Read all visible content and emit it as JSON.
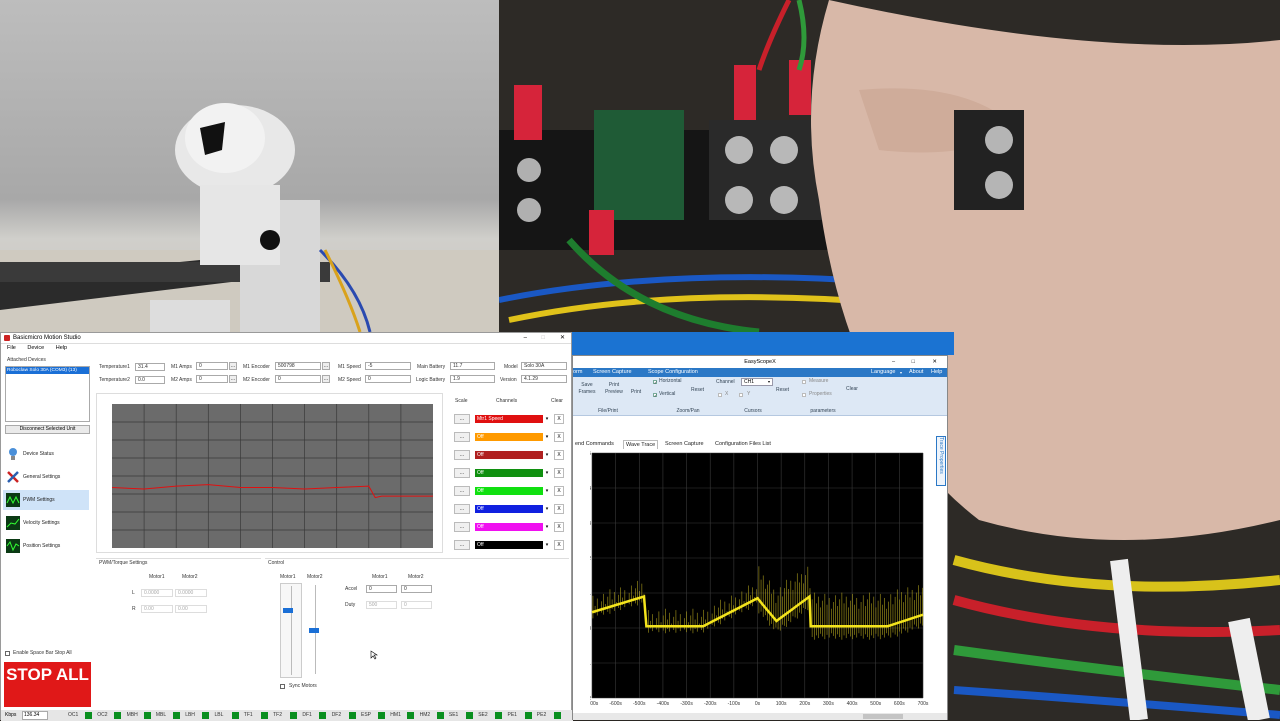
{
  "motion_studio": {
    "title": "Basicmicro Motion Studio",
    "menu": [
      "File",
      "Device",
      "Help"
    ],
    "attached_devices_label": "Attached Devices",
    "device_item": "Roboclaw Solo 30A (COM3) (13)",
    "disconnect_button": "Disconnect Selected Unit",
    "nav": [
      "Device Status",
      "General Settings",
      "PWM Settings",
      "Velocity Settings",
      "Position Settings"
    ],
    "active_nav": "PWM Settings",
    "readouts": {
      "temp1_label": "Temperature1",
      "temp1": "31.4",
      "temp2_label": "Temperature2",
      "temp2": "0.0",
      "m1amps_label": "M1 Amps",
      "m1amps": "0",
      "m2amps_label": "M2 Amps",
      "m2amps": "0",
      "m1enc_label": "M1 Encoder",
      "m1enc": "500798",
      "m2enc_label": "M2 Encoder",
      "m2enc": "0",
      "m1speed_label": "M1 Speed",
      "m1speed": "-5",
      "m2speed_label": "M2 Speed",
      "m2speed": "0",
      "mainbatt_label": "Main Battery",
      "mainbatt": "11.7",
      "logicbatt_label": "Logic Battery",
      "logicbatt": "1.9",
      "model_label": "Model",
      "model": "Solo 30A",
      "version_label": "Version",
      "version": "4.1.29"
    },
    "channels_header": {
      "scale": "Scale",
      "channels": "Channels",
      "clear": "Clear"
    },
    "channels": [
      {
        "label": "Mtr1 Speed",
        "color": "#e01010"
      },
      {
        "label": "Off",
        "color": "#ff9a00"
      },
      {
        "label": "Off",
        "color": "#b02020"
      },
      {
        "label": "Off",
        "color": "#109010"
      },
      {
        "label": "Off",
        "color": "#10e010"
      },
      {
        "label": "Off",
        "color": "#1020e0"
      },
      {
        "label": "Off",
        "color": "#f010f0"
      },
      {
        "label": "Off",
        "color": "#000000"
      }
    ],
    "pwm_panel": {
      "title": "PWM/Torque Settings",
      "col1": "Motor1",
      "col2": "Motor2",
      "rows": [
        {
          "label": "L",
          "m1": "0.0000",
          "m2": "0.0000"
        },
        {
          "label": "R",
          "m1": "0.00",
          "m2": "0.00"
        }
      ]
    },
    "control_panel": {
      "title": "Control",
      "slider1": "Motor1",
      "slider2": "Motor2",
      "col1": "Motor1",
      "col2": "Motor2",
      "accel_label": "Accel",
      "accel_m1": "0",
      "accel_m2": "0",
      "duty_label": "Duty",
      "duty_m1": "500",
      "duty_m2": "0",
      "sync_label": "Sync Motors"
    },
    "space_stop_label": "Enable Space Bar Stop All",
    "stop_all": "STOP ALL",
    "status": {
      "kbps_label": "Kbps",
      "kbps": "136.34",
      "leds": [
        "OC1",
        "OC2",
        "MBH",
        "MBL",
        "LBH",
        "LBL",
        "TF1",
        "TF2",
        "DF1",
        "DF2",
        "ESP",
        "HM1",
        "HM2",
        "SE1",
        "SE2",
        "PE1",
        "PE2"
      ]
    }
  },
  "scope": {
    "title": "EasyScopeX",
    "ribbon_tabs": [
      "orm",
      "Screen Capture",
      "Scope Configuration"
    ],
    "ribbon_right": [
      "Language",
      "About",
      "Help"
    ],
    "groups": {
      "fileprint": {
        "save": "Save Frames",
        "print_preview": "Print Preview",
        "print": "Print",
        "label": "File/Print"
      },
      "zoompan": {
        "horizontal": "Horizontal",
        "vertical": "Vertical",
        "reset": "Reset",
        "label": "Zoom/Pan"
      },
      "cursors": {
        "channel_label": "Channel",
        "channel": "CH1",
        "x": "X",
        "y": "Y",
        "reset": "Reset",
        "label": "Cursors"
      },
      "params": {
        "measure": "Measure",
        "properties": "Properties",
        "clear": "Clear",
        "label": "parameters"
      }
    },
    "tabs": [
      "end Commands",
      "Wave Trace",
      "Screen Capture",
      "Configuration Files List"
    ],
    "active_tab": "Wave Trace",
    "side_tab": "Trace Properties",
    "chart_data": {
      "type": "line",
      "x_ticks": [
        "-700s",
        "-600s",
        "-500s",
        "-400s",
        "-300s",
        "-200s",
        "-100s",
        "0s",
        "100s",
        "200s",
        "300s",
        "400s",
        "500s",
        "600s",
        "700s"
      ],
      "y_ticks": [
        "5",
        "4",
        "3",
        "2",
        "1",
        "0",
        "-1",
        "-2"
      ],
      "xlim": [
        -700,
        700
      ],
      "ylim": [
        -2,
        5
      ],
      "series": [
        {
          "color": "#f4e41c",
          "points": [
            [
              -700,
              0.45
            ],
            [
              -480,
              0.9
            ],
            [
              -470,
              0.05
            ],
            [
              -230,
              0.05
            ],
            [
              0,
              0.85
            ],
            [
              80,
              0.2
            ],
            [
              220,
              0.9
            ],
            [
              225,
              0.05
            ],
            [
              550,
              0.05
            ],
            [
              700,
              0.38
            ]
          ]
        }
      ]
    }
  },
  "desktop_chart": {
    "chart_data": {
      "type": "line",
      "series": [
        {
          "color": "#e01010",
          "points": [
            [
              0,
              0.58
            ],
            [
              10,
              0.59
            ],
            [
              20,
              0.57
            ],
            [
              30,
              0.56
            ],
            [
              40,
              0.58
            ],
            [
              50,
              0.58
            ],
            [
              60,
              0.59
            ],
            [
              70,
              0.58
            ],
            [
              80,
              0.57
            ],
            [
              82,
              0.65
            ],
            [
              84,
              0.64
            ],
            [
              100,
              0.64
            ]
          ]
        }
      ]
    }
  }
}
